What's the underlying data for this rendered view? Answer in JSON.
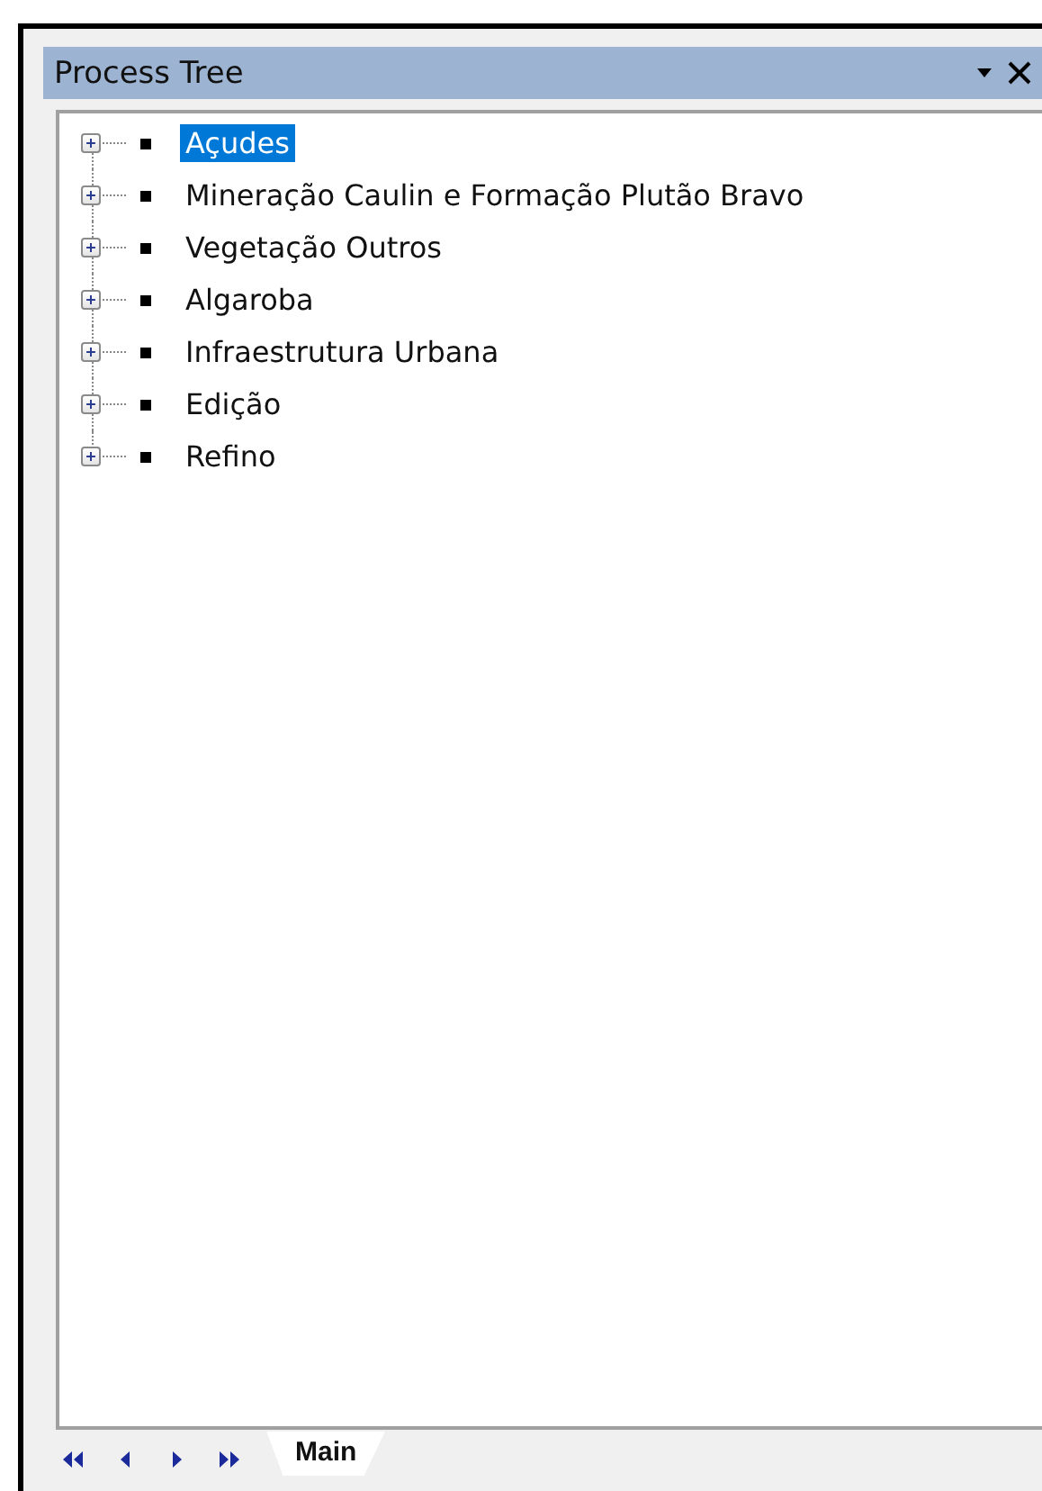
{
  "panel": {
    "title": "Process Tree"
  },
  "tree": {
    "items": [
      {
        "label": "Açudes",
        "selected": true,
        "expanded": false
      },
      {
        "label": "Mineração Caulin e Formação Plutão Bravo",
        "selected": false,
        "expanded": false
      },
      {
        "label": "Vegetação Outros",
        "selected": false,
        "expanded": false
      },
      {
        "label": "Algaroba",
        "selected": false,
        "expanded": false
      },
      {
        "label": "Infraestrutura Urbana",
        "selected": false,
        "expanded": false
      },
      {
        "label": "Edição",
        "selected": false,
        "expanded": false
      },
      {
        "label": "Refino",
        "selected": false,
        "expanded": false
      }
    ]
  },
  "sheet_tabs": [
    {
      "label": "Main",
      "selected": true
    }
  ]
}
